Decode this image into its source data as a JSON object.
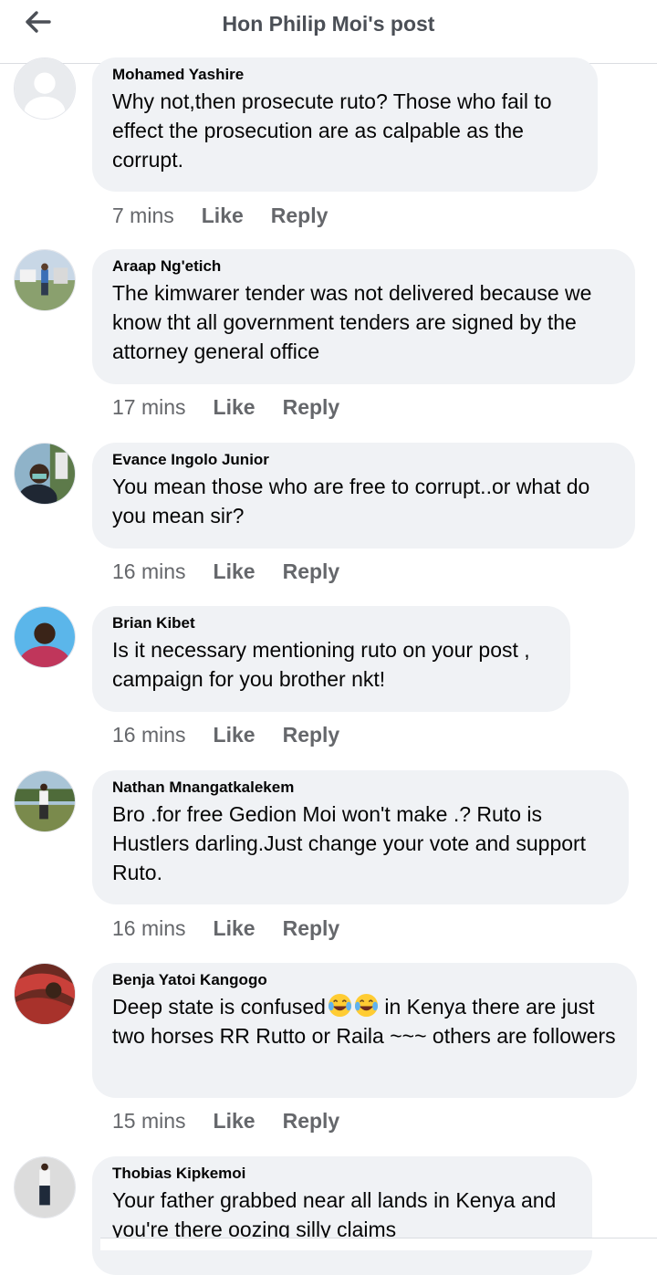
{
  "header": {
    "title": "Hon Philip Moi's post",
    "back_icon": "arrow-left-icon"
  },
  "comments": [
    {
      "author": "Mohamed Yashire",
      "text": "Why not,then  prosecute ruto? Those who fail to effect the prosecution are as calpable as the corrupt.",
      "time": "7 mins",
      "like": "Like",
      "reply": "Reply",
      "avatar": "default-avatar"
    },
    {
      "author": "Araap Ng'etich",
      "text": "The kimwarer tender was not delivered because we know tht all government tenders are signed by the attorney general office",
      "time": "17 mins",
      "like": "Like",
      "reply": "Reply",
      "avatar": "photo-avatar"
    },
    {
      "author": "Evance Ingolo Junior",
      "text": "You mean those who are free to corrupt..or what do you mean sir?",
      "time": "16 mins",
      "like": "Like",
      "reply": "Reply",
      "avatar": "photo-avatar"
    },
    {
      "author": "Brian Kibet",
      "text": "Is it necessary mentioning ruto on your post , campaign for you brother nkt!",
      "time": "16 mins",
      "like": "Like",
      "reply": "Reply",
      "avatar": "photo-avatar"
    },
    {
      "author": "Nathan Mnangatkalekem",
      "text": "Bro .for free Gedion Moi won't make .? Ruto is Hustlers darling.Just change your vote and support Ruto.",
      "time": "16 mins",
      "like": "Like",
      "reply": "Reply",
      "avatar": "photo-avatar"
    },
    {
      "author": "Benja Yatoi Kangogo",
      "text_before": "Deep state is confused",
      "text_after": " in Kenya there are just two horses RR Rutto or Raila ~~~ others are followers",
      "emoji": "tears-of-joy-emoji",
      "time": "15 mins",
      "like": "Like",
      "reply": "Reply",
      "avatar": "photo-avatar"
    },
    {
      "author": "Thobias Kipkemoi",
      "text": "Your father grabbed near all lands in Kenya and you're there oozing silly claims",
      "avatar": "photo-avatar"
    }
  ]
}
